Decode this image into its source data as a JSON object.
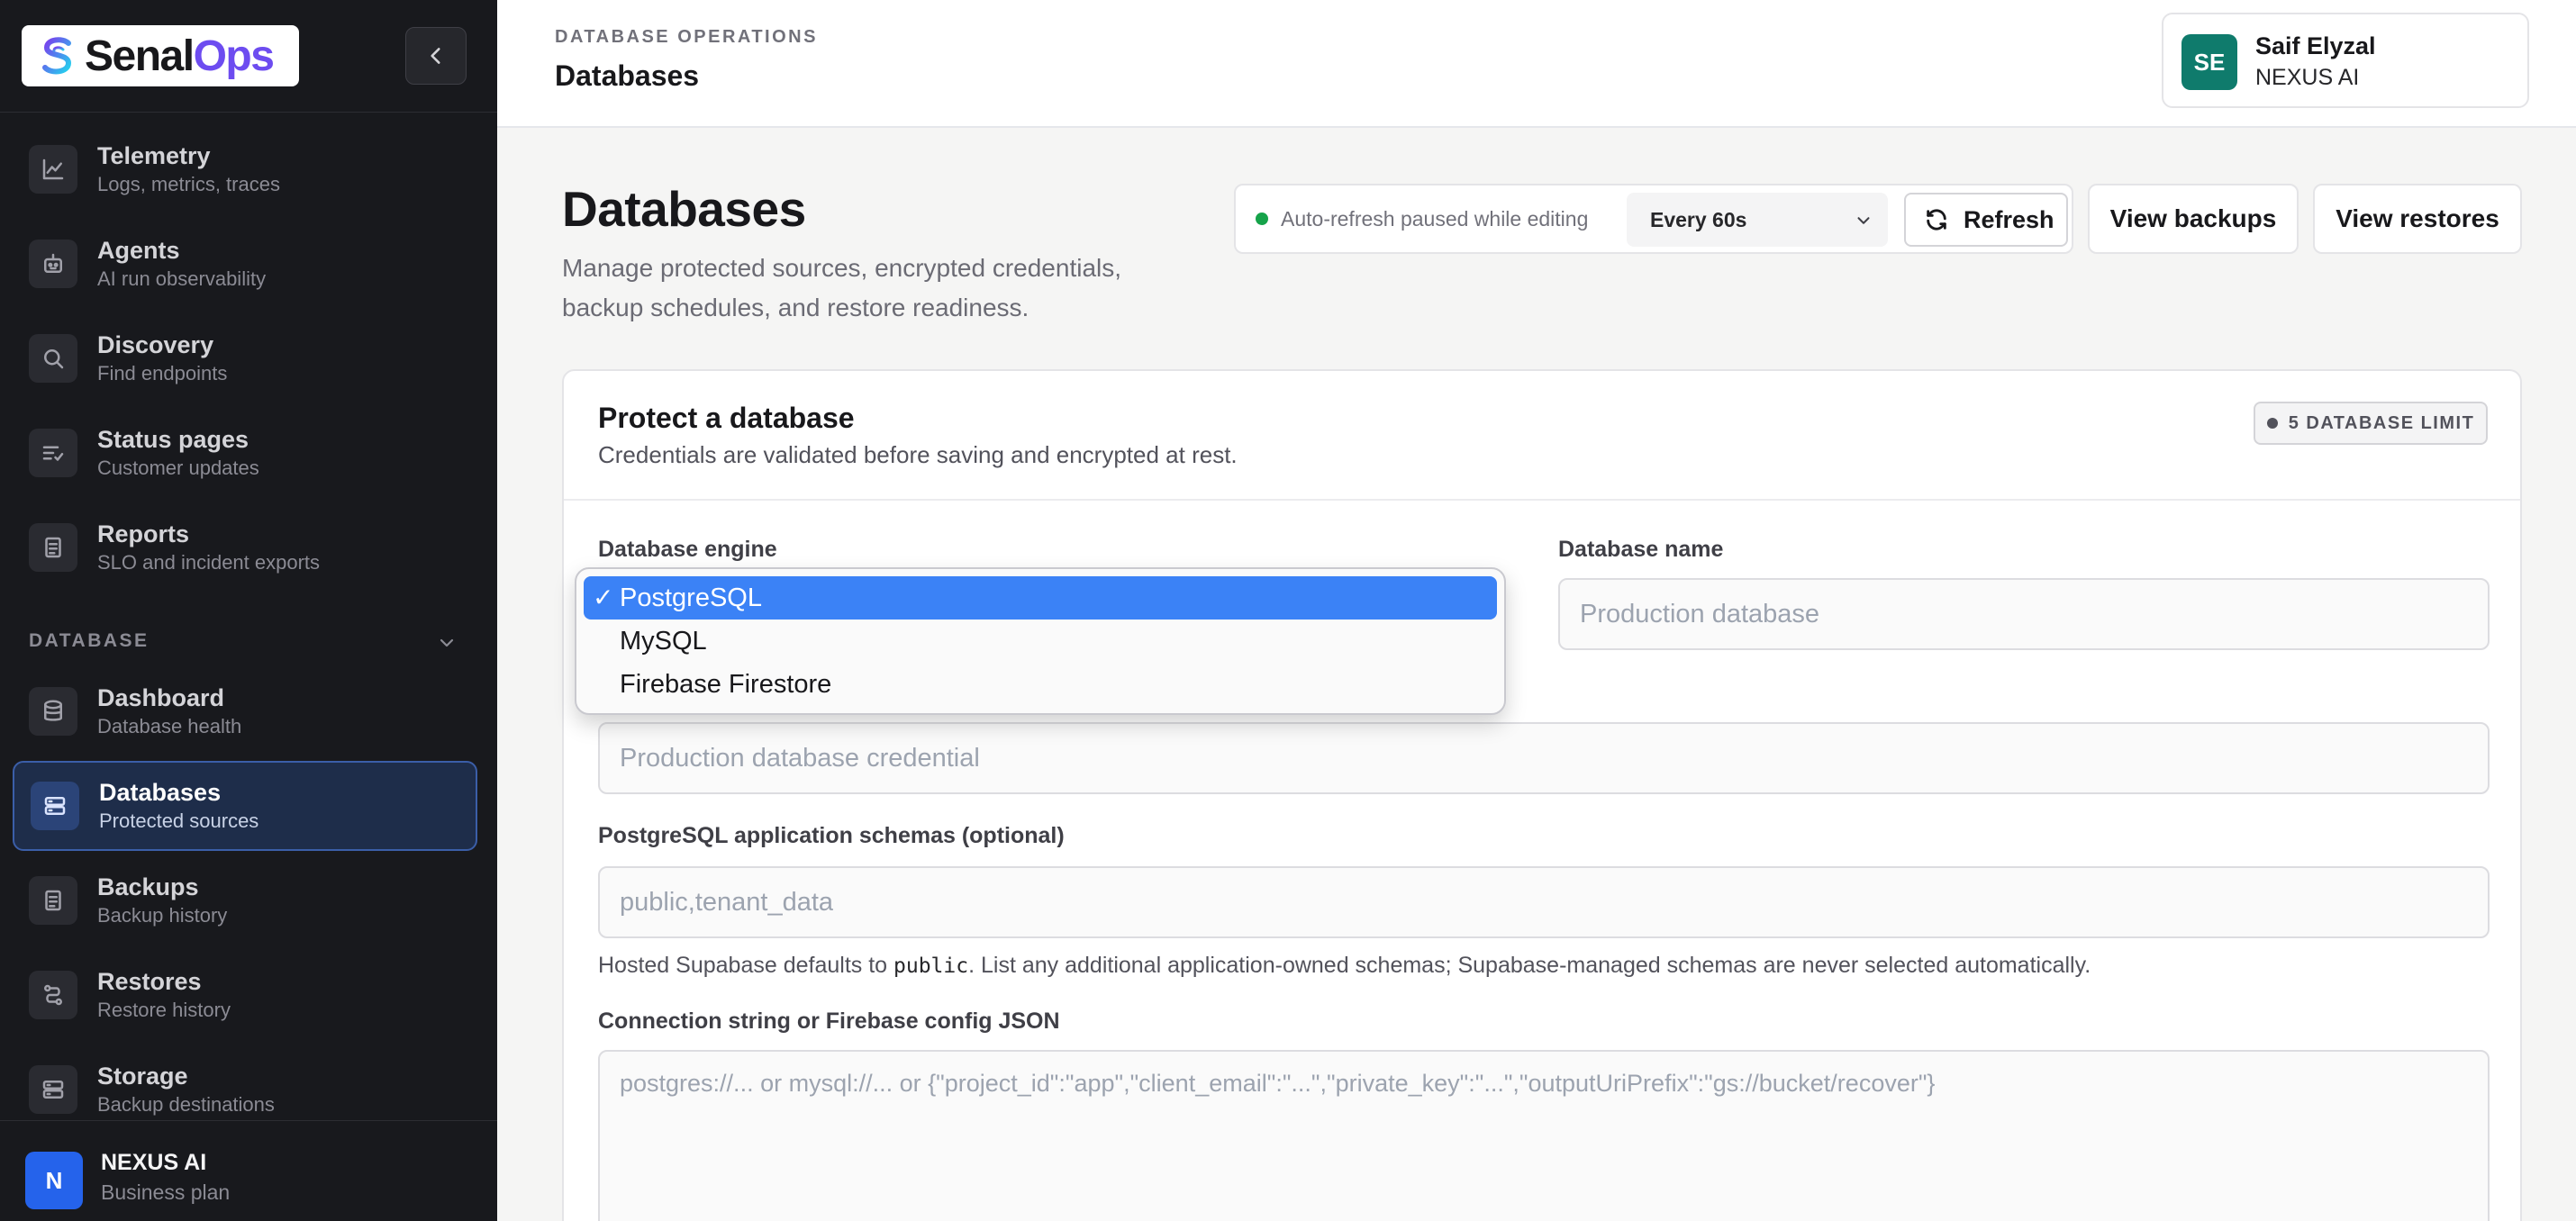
{
  "brand": {
    "name_part1": "Senal",
    "name_part2": "Ops"
  },
  "sidebar": {
    "nav_items": [
      {
        "title": "Telemetry",
        "subtitle": "Logs, metrics, traces",
        "icon": "chart-line-icon"
      },
      {
        "title": "Agents",
        "subtitle": "AI run observability",
        "icon": "robot-icon"
      },
      {
        "title": "Discovery",
        "subtitle": "Find endpoints",
        "icon": "search-icon"
      },
      {
        "title": "Status pages",
        "subtitle": "Customer updates",
        "icon": "list-check-icon"
      },
      {
        "title": "Reports",
        "subtitle": "SLO and incident exports",
        "icon": "document-icon"
      }
    ],
    "section_label": "DATABASE",
    "db_items": [
      {
        "title": "Dashboard",
        "subtitle": "Database health",
        "icon": "database-icon"
      },
      {
        "title": "Databases",
        "subtitle": "Protected sources",
        "icon": "server-icon",
        "active": true
      },
      {
        "title": "Backups",
        "subtitle": "Backup history",
        "icon": "document-icon"
      },
      {
        "title": "Restores",
        "subtitle": "Restore history",
        "icon": "route-icon"
      },
      {
        "title": "Storage",
        "subtitle": "Backup destinations",
        "icon": "server-icon"
      }
    ],
    "org": {
      "initial": "N",
      "name": "NEXUS AI",
      "plan": "Business plan"
    }
  },
  "header": {
    "breadcrumb": "DATABASE OPERATIONS",
    "title": "Databases",
    "user": {
      "initials": "SE",
      "name": "Saif Elyzal",
      "org": "NEXUS AI"
    }
  },
  "page": {
    "title": "Databases",
    "description": "Manage protected sources, encrypted credentials, backup schedules, and restore readiness.",
    "refresh": {
      "status": "Auto-refresh paused while editing",
      "interval": "Every 60s",
      "refresh_label": "Refresh"
    },
    "view_backups_label": "View backups",
    "view_restores_label": "View restores"
  },
  "form": {
    "title": "Protect a database",
    "subtitle": "Credentials are validated before saving and encrypted at rest.",
    "limit_badge": "5 DATABASE LIMIT",
    "engine_label": "Database engine",
    "name_label": "Database name",
    "name_placeholder": "Production database",
    "credential_placeholder": "Production database credential",
    "schemas_label": "PostgreSQL application schemas (optional)",
    "schemas_placeholder": "public,tenant_data",
    "help_prefix": "Hosted Supabase defaults to ",
    "help_code": "public",
    "help_suffix": ". List any additional application-owned schemas; Supabase-managed schemas are never selected automatically.",
    "connection_label": "Connection string or Firebase config JSON",
    "connection_placeholder": "postgres://... or mysql://... or {\"project_id\":\"app\",\"client_email\":\"...\",\"private_key\":\"...\",\"outputUriPrefix\":\"gs://bucket/recover\"}"
  },
  "dropdown": {
    "check_glyph": "✓",
    "options": [
      {
        "label": "PostgreSQL",
        "selected": true
      },
      {
        "label": "MySQL",
        "selected": false
      },
      {
        "label": "Firebase Firestore",
        "selected": false
      }
    ]
  },
  "colors": {
    "accent": "#3b82f6",
    "sidebar_bg": "#18191d",
    "active_nav": "#1e2d4a",
    "status_green": "#16a34a",
    "avatar_teal": "#0f7b6c"
  }
}
